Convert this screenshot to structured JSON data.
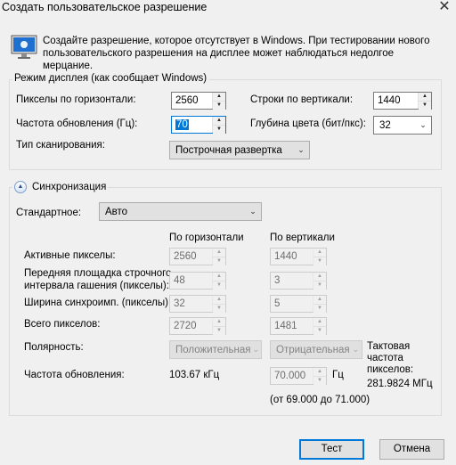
{
  "window": {
    "title": "Создать пользовательское разрешение",
    "close": "✕"
  },
  "intro": "Создайте разрешение, которое отсутствует в Windows. При тестировании нового пользовательского разрешения на дисплее может наблюдаться недолгое мерцание.",
  "display_mode": {
    "group_label": "Режим дисплея (как сообщает Windows)",
    "h_pixels_label": "Пикселы по горизонтали:",
    "h_pixels": "2560",
    "v_lines_label": "Строки по вертикали:",
    "v_lines": "1440",
    "refresh_label": "Частота обновления (Гц):",
    "refresh": "70",
    "depth_label": "Глубина цвета (бит/пкс):",
    "depth": "32",
    "scan_label": "Тип сканирования:",
    "scan": "Построчная развертка"
  },
  "sync": {
    "label": "Синхронизация",
    "standard_label": "Стандартное:",
    "standard": "Авто",
    "col_h": "По горизонтали",
    "col_v": "По вертикали",
    "rows": [
      {
        "label": "Активные пикселы:",
        "h": "2560",
        "v": "1440"
      },
      {
        "label": "Передняя площадка строчного\nинтервала гашения (пикселы):",
        "h": "48",
        "v": "3"
      },
      {
        "label": "Ширина синхроимп. (пикселы):",
        "h": "32",
        "v": "5"
      },
      {
        "label": "Всего пикселов:",
        "h": "2720",
        "v": "1481"
      }
    ],
    "polarity_label": "Полярность:",
    "polarity_h": "Положительная",
    "polarity_v": "Отрицательная",
    "refresh_label": "Частота обновления:",
    "h_freq": "103.67 кГц",
    "v_freq": "70.000",
    "v_unit": "Гц",
    "range": "(от 69.000 до 71.000)",
    "pixel_clock_label": "Тактовая частота пикселов:",
    "pixel_clock": "281.9824 МГц"
  },
  "buttons": {
    "test": "Тест",
    "cancel": "Отмена"
  }
}
